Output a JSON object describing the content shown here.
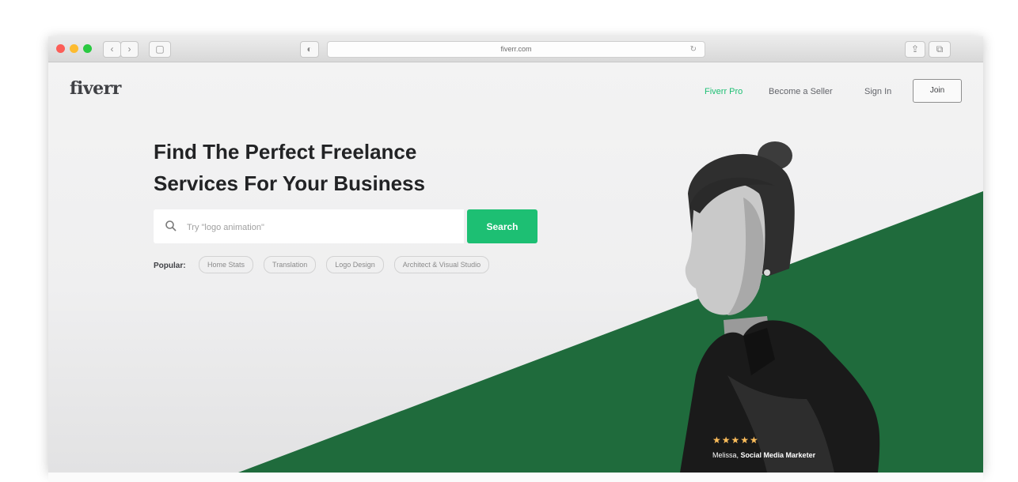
{
  "browser": {
    "url": "fiverr.com",
    "nav_back": "‹",
    "nav_forward": "›",
    "sidebar_icon": "▢",
    "privacy_icon": "◐",
    "reload_icon": "↻",
    "share_icon": "⇪",
    "tabs_icon": "⧉"
  },
  "header": {
    "logo": "fiverr",
    "nav": {
      "pro": "Fiverr Pro",
      "seller": "Become a Seller",
      "signin": "Sign In",
      "join": "Join"
    }
  },
  "hero": {
    "headline_line1": "Find The Perfect Freelance",
    "headline_line2": "Services For Your Business",
    "search_placeholder": "Try \"logo animation\"",
    "search_button": "Search",
    "popular_label": "Popular:",
    "popular_tags": [
      "Home Stats",
      "Translation",
      "Logo Design",
      "Architect & Visual Studio"
    ],
    "rating_stars": "★★★★★",
    "caption_name": "Melissa,",
    "caption_role": "Social Media Marketer"
  },
  "colors": {
    "brand_green": "#1dbf73",
    "hero_dark_green": "#1f6b3c",
    "star_yellow": "#ffbe5b"
  }
}
